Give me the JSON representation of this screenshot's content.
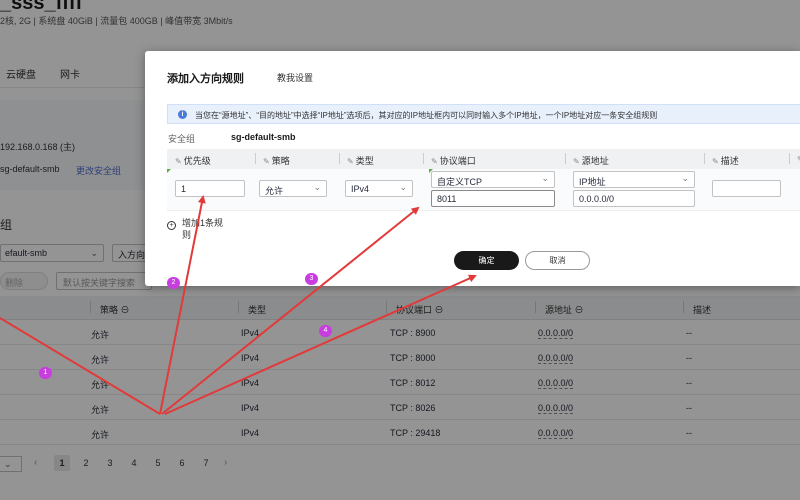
{
  "background": {
    "title": "_sss_ffff",
    "subtitle": "2核, 2G | 系统盘 40GiB | 流量包 400GB | 峰值带宽 3Mbit/s",
    "tabs": [
      "云硬盘",
      "网卡"
    ],
    "private_ip": "192.168.0.168 (主)",
    "security_group": "sg-default-smb",
    "change_sg_link": "更改安全组",
    "section_title": "组",
    "sg_select": "efault-smb",
    "direction_button": "入方向",
    "delete_button": "删除",
    "search_placeholder": "默认按关键字搜索",
    "table": {
      "headers": [
        "策略",
        "类型",
        "协议端口",
        "源地址",
        "描述"
      ],
      "rows": [
        {
          "policy": "允许",
          "type": "IPv4",
          "port": "TCP : 8900",
          "source": "0.0.0.0/0",
          "desc": "--"
        },
        {
          "policy": "允许",
          "type": "IPv4",
          "port": "TCP : 8000",
          "source": "0.0.0.0/0",
          "desc": "--"
        },
        {
          "policy": "允许",
          "type": "IPv4",
          "port": "TCP : 8012",
          "source": "0.0.0.0/0",
          "desc": "--"
        },
        {
          "policy": "允许",
          "type": "IPv4",
          "port": "TCP : 8026",
          "source": "0.0.0.0/0",
          "desc": "--"
        },
        {
          "policy": "允许",
          "type": "IPv4",
          "port": "TCP : 29418",
          "source": "0.0.0.0/0",
          "desc": "--"
        }
      ]
    },
    "pagination": {
      "pages": [
        "1",
        "2",
        "3",
        "4",
        "5",
        "6",
        "7"
      ],
      "active": "1",
      "prev": "‹",
      "next": "›"
    }
  },
  "dialog": {
    "title": "添加入方向规则",
    "help_link": "教我设置",
    "notice": "当您在“源地址”、“目的地址”中选择“IP地址”选项后，其对应的IP地址框内可以同时输入多个IP地址，一个IP地址对应一条安全组规则",
    "sg_label": "安全组",
    "sg_value": "sg-default-smb",
    "columns": [
      "优先级",
      "策略",
      "类型",
      "协议端口",
      "源地址",
      "描述"
    ],
    "rule": {
      "priority": "1",
      "policy": "允许",
      "type": "IPv4",
      "protocol": "自定义TCP",
      "port": "8011",
      "source_type": "IP地址",
      "source_ip": "0.0.0.0/0",
      "description": ""
    },
    "add_rule": "增加1条规则",
    "ok_button": "确定",
    "cancel_button": "取消"
  },
  "annotations": {
    "badges": [
      "1",
      "2",
      "3",
      "4"
    ],
    "arrow_color": "#e23a3a",
    "badge_color": "#c83de0"
  }
}
